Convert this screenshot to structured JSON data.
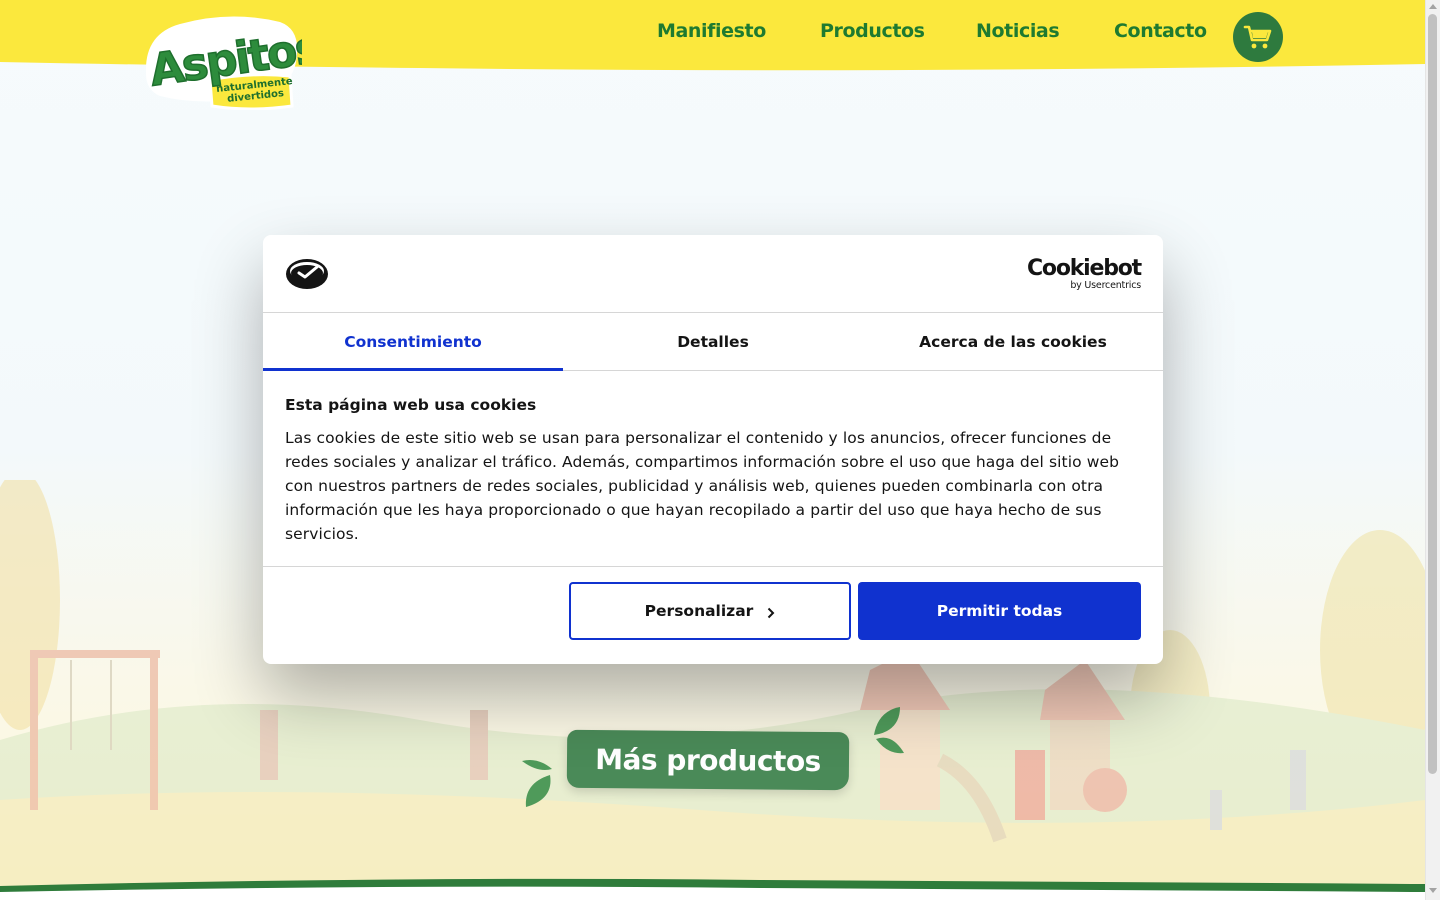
{
  "header": {
    "nav": [
      "Manifiesto",
      "Productos",
      "Noticias",
      "Contacto"
    ],
    "cart_icon": "cart-icon",
    "logo": {
      "main": "Aspitos",
      "tagline_line1": "naturalmente",
      "tagline_line2": "divertidos"
    }
  },
  "main": {
    "more_products_label": "Más productos"
  },
  "cookie_dialog": {
    "brand": {
      "name": "Cookiebot",
      "by": "by Usercentrics"
    },
    "tabs": [
      "Consentimiento",
      "Detalles",
      "Acerca de las cookies"
    ],
    "active_tab": "Consentimiento",
    "title": "Esta página web usa cookies",
    "body": "Las cookies de este sitio web se usan para personalizar el contenido y los anuncios, ofrecer funciones de redes sociales y analizar el tráfico. Además, compartimos información sobre el uso que haga del sitio web con nuestros partners de redes sociales, publicidad y análisis web, quienes pueden combinarla con otra información que les haya proporcionado o que hayan recopilado a partir del uso que haya hecho de sus servicios.",
    "customize_label": "Personalizar",
    "allow_all_label": "Permitir todas"
  },
  "colors": {
    "header_yellow": "#fbe83d",
    "brand_green": "#1e7a30",
    "cookiebot_blue": "#1032cf"
  }
}
